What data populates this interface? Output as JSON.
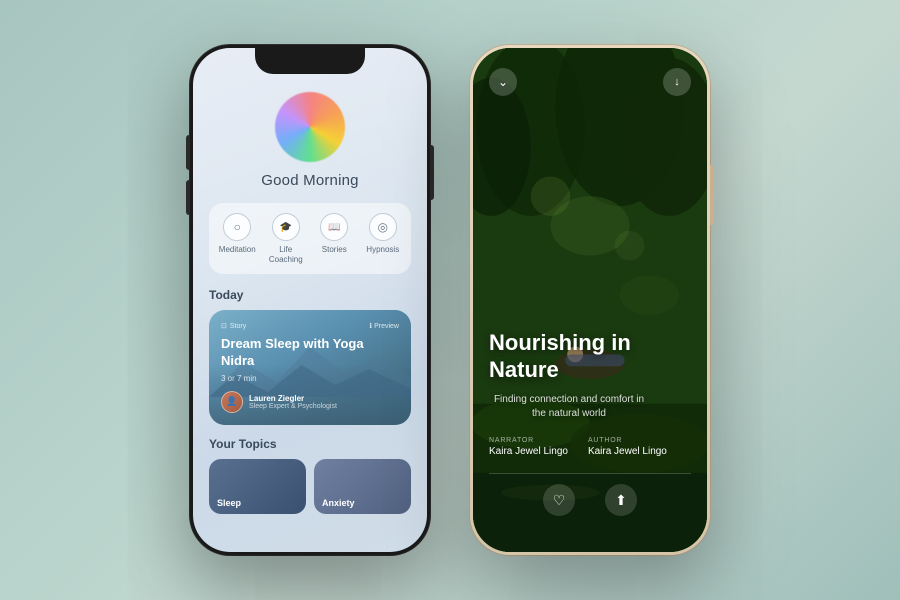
{
  "background": {
    "color_start": "#a8c5c0",
    "color_end": "#a0bfba"
  },
  "phone_left": {
    "greeting": "Good Morning",
    "categories": [
      {
        "id": "meditation",
        "label": "Meditation",
        "icon": "○"
      },
      {
        "id": "life-coaching",
        "label": "Life Coaching",
        "icon": "🎓"
      },
      {
        "id": "stories",
        "label": "Stories",
        "icon": "📖"
      },
      {
        "id": "hypnosis",
        "label": "Hypnosis",
        "icon": "◎"
      }
    ],
    "today_section": {
      "title": "Today",
      "card": {
        "type_badge": "Story",
        "preview_label": "Preview",
        "title": "Dream Sleep with Yoga Nidra",
        "duration": "3 or 7 min",
        "author_name": "Lauren Ziegler",
        "author_title": "Sleep Expert & Psychologist"
      }
    },
    "your_topics": {
      "title": "Your Topics",
      "topics": [
        {
          "label": "Sleep"
        },
        {
          "label": "Anxiety"
        }
      ]
    }
  },
  "phone_right": {
    "title": "Nourishing in Nature",
    "subtitle": "Finding connection and comfort in the natural world",
    "narrator_label": "NARRATOR",
    "author_label": "AUTHOR",
    "narrator_name": "Kaira Jewel Lingo",
    "author_name": "Kaira Jewel Lingo",
    "actions": {
      "back_icon": "chevron-down",
      "download_icon": "cloud-download",
      "heart_icon": "heart",
      "share_icon": "share"
    }
  }
}
